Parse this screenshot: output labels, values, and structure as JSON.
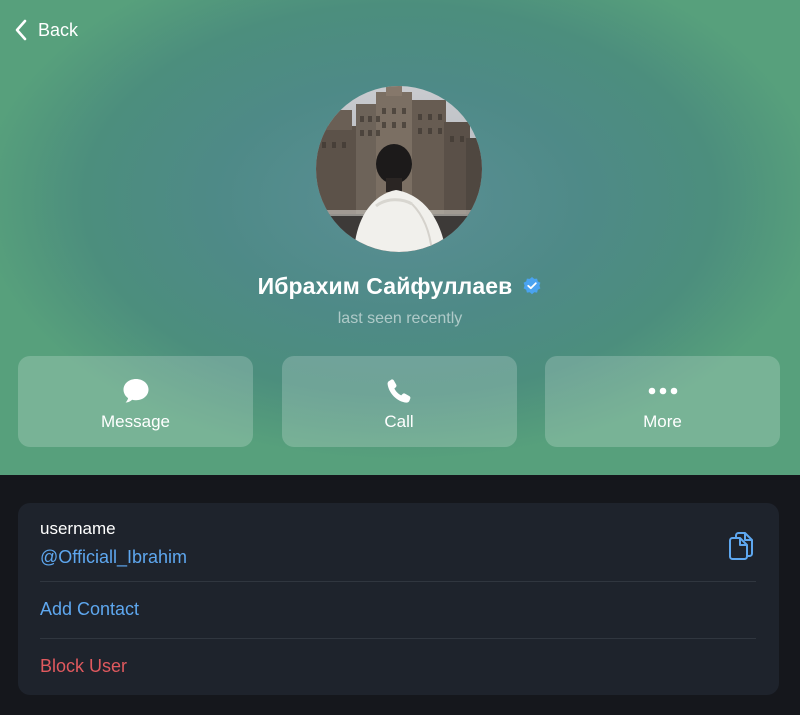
{
  "nav": {
    "back_label": "Back",
    "back_icon": "chevron-left-icon"
  },
  "profile": {
    "name": "Ибрахим Сайфуллаев",
    "status": "last seen recently",
    "verified": true,
    "verified_icon": "verified-badge-icon",
    "avatar_description_icon": "profile-photo"
  },
  "actions": [
    {
      "label": "Message",
      "icon": "chat-bubble-icon"
    },
    {
      "label": "Call",
      "icon": "phone-icon"
    },
    {
      "label": "More",
      "icon": "more-dots-icon"
    }
  ],
  "info": {
    "username_label": "username",
    "username_value": "@Officiall_Ibrahim",
    "copy_icon": "copy-icon",
    "add_contact_label": "Add Contact",
    "block_user_label": "Block User"
  },
  "colors": {
    "link": "#5ea7ef",
    "danger": "#e0595e",
    "card_bg": "#1e232c",
    "page_bg": "#15171c",
    "header_gradient_top": "#5b8f95",
    "header_gradient_bottom": "#57a07c"
  }
}
